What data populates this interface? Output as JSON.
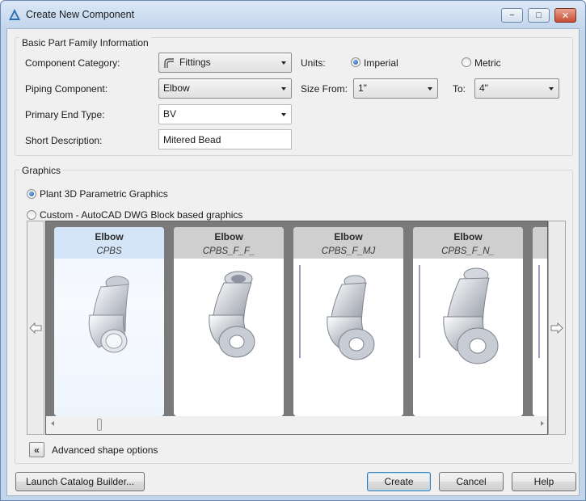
{
  "window": {
    "title": "Create New Component",
    "controls": {
      "minimize": "−",
      "maximize": "□",
      "close": "✕"
    }
  },
  "basic": {
    "legend": "Basic Part Family Information",
    "category_label": "Component Category:",
    "category_value": "Fittings",
    "category_icon": "fitting-icon",
    "piping_label": "Piping Component:",
    "piping_value": "Elbow",
    "end_type_label": "Primary End Type:",
    "end_type_value": "BV",
    "short_desc_label": "Short Description:",
    "short_desc_value": "Mitered Bead",
    "units_label": "Units:",
    "units_options": [
      "Imperial",
      "Metric"
    ],
    "units_selected": "Imperial",
    "size_from_label": "Size From:",
    "size_from_value": "1\"",
    "to_label": "To:",
    "to_value": "4\""
  },
  "graphics": {
    "legend": "Graphics",
    "option_parametric": "Plant 3D Parametric Graphics",
    "option_custom": "Custom - AutoCAD DWG Block based graphics",
    "selected": "Plant 3D Parametric Graphics",
    "cards": [
      {
        "name": "Elbow",
        "code": "CPBS",
        "selected": true
      },
      {
        "name": "Elbow",
        "code": "CPBS_F_F_",
        "selected": false
      },
      {
        "name": "Elbow",
        "code": "CPBS_F_MJ",
        "selected": false
      },
      {
        "name": "Elbow",
        "code": "CPBS_F_N_",
        "selected": false
      }
    ],
    "advanced_label": "Advanced shape options"
  },
  "buttons": {
    "launch": "Launch Catalog Builder...",
    "create": "Create",
    "cancel": "Cancel",
    "help": "Help"
  },
  "colors": {
    "accent": "#3c7fb1",
    "selected_card": "#d5e5f8",
    "gallery_bg": "#7a7a7a"
  }
}
